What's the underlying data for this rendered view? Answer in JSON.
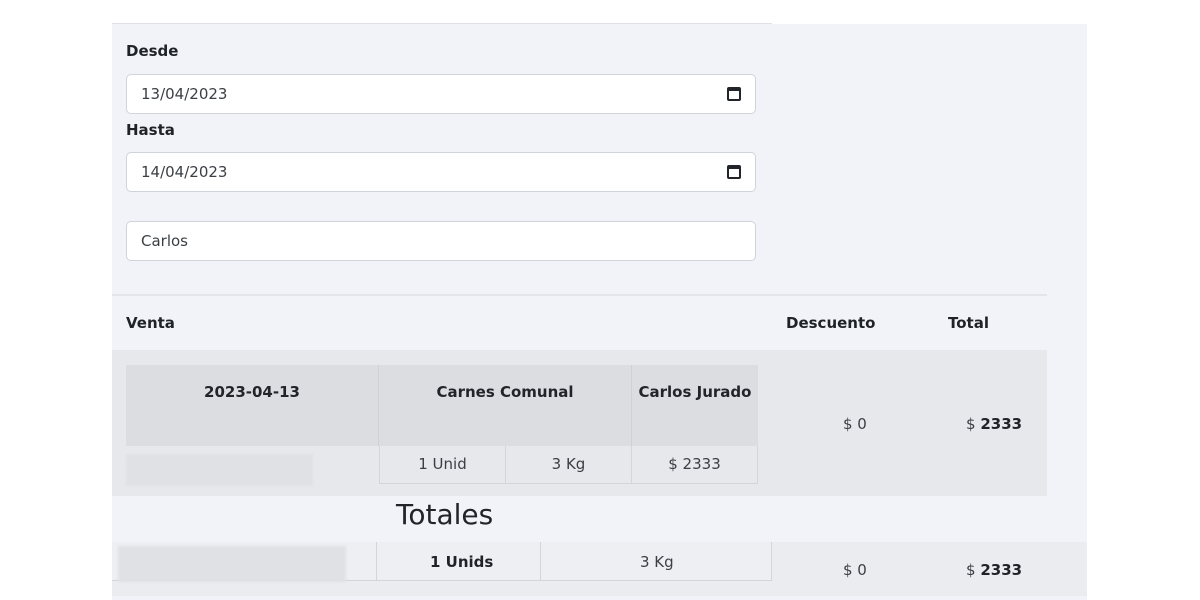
{
  "filters": {
    "desde_label": "Desde",
    "desde_value": "13/04/2023",
    "hasta_label": "Hasta",
    "hasta_value": "14/04/2023",
    "cliente_value": "Carlos"
  },
  "table": {
    "headers": {
      "venta": "Venta",
      "descuento": "Descuento",
      "total": "Total"
    },
    "rows": [
      {
        "fecha": "2023-04-13",
        "vendedor": "Carnes Comunal",
        "cliente": "Carlos Jurado",
        "unidades": "1 Unid",
        "peso": "3 Kg",
        "subtotal": "$ 2333",
        "descuento": "$ 0",
        "total_prefix": "$",
        "total_value": "2333"
      }
    ]
  },
  "totales": {
    "title": "Totales",
    "unidades": "1 Unids",
    "peso": "3 Kg",
    "descuento": "$ 0",
    "total_prefix": "$",
    "total_value": "2333"
  }
}
